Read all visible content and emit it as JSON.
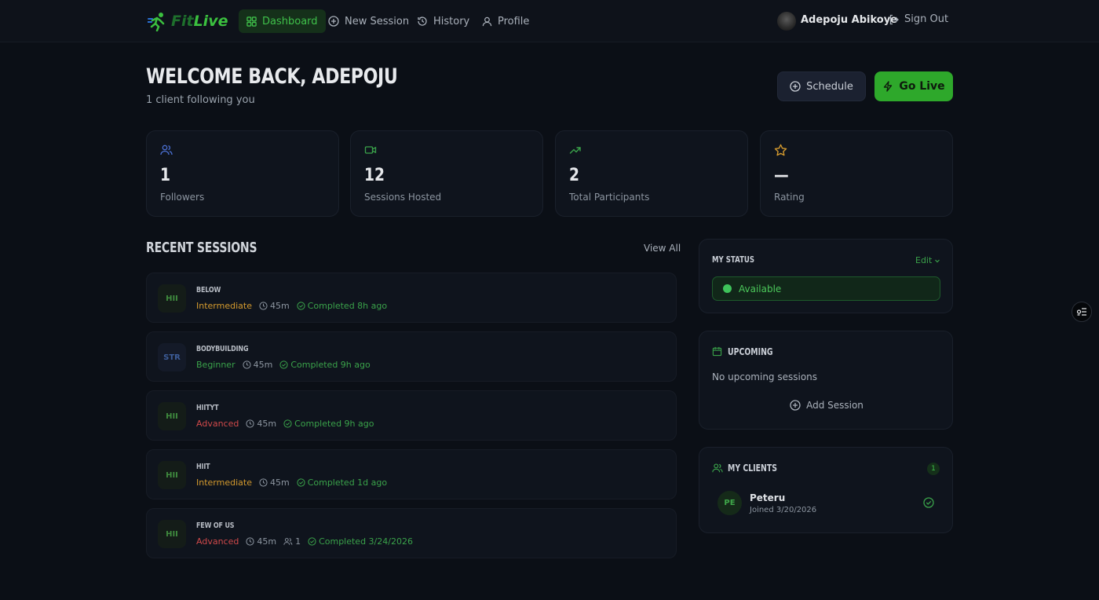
{
  "nav": {
    "logo_fit": "Fit",
    "logo_live": "Live",
    "items": [
      {
        "label": "Dashboard",
        "icon": "grid-icon",
        "active": true
      },
      {
        "label": "New Session",
        "icon": "plus-circle-icon"
      },
      {
        "label": "History",
        "icon": "history-icon"
      },
      {
        "label": "Profile",
        "icon": "user-icon"
      }
    ],
    "user_name": "Adepoju Abikoye",
    "sign_out": "Sign Out"
  },
  "header": {
    "welcome": "WELCOME BACK, ADEPOJU",
    "subtitle": "1 client following you",
    "schedule_label": "Schedule",
    "golive_label": "Go Live"
  },
  "stats": [
    {
      "value": "1",
      "label": "Followers",
      "icon": "users-icon",
      "color": "#4a6fd1"
    },
    {
      "value": "12",
      "label": "Sessions Hosted",
      "icon": "video-icon",
      "color": "#3aa24a"
    },
    {
      "value": "2",
      "label": "Total Participants",
      "icon": "trending-up-icon",
      "color": "#3aa24a"
    },
    {
      "value": "—",
      "label": "Rating",
      "icon": "star-icon",
      "color": "#d49a2e"
    }
  ],
  "recent": {
    "title": "RECENT SESSIONS",
    "view_all": "View All",
    "sessions": [
      {
        "badge": "HII",
        "title": "BELOW",
        "level": "Intermediate",
        "duration": "45m",
        "participants": "",
        "status": "Completed 8h ago"
      },
      {
        "badge": "STR",
        "title": "BODYBUILDING",
        "level": "Beginner",
        "duration": "45m",
        "participants": "",
        "status": "Completed 9h ago"
      },
      {
        "badge": "HII",
        "title": "HIITYT",
        "level": "Advanced",
        "duration": "45m",
        "participants": "",
        "status": "Completed 9h ago"
      },
      {
        "badge": "HII",
        "title": "HIIT",
        "level": "Intermediate",
        "duration": "45m",
        "participants": "",
        "status": "Completed 1d ago"
      },
      {
        "badge": "HII",
        "title": "FEW OF US",
        "level": "Advanced",
        "duration": "45m",
        "participants": "1",
        "status": "Completed 3/24/2026"
      }
    ]
  },
  "status_panel": {
    "title": "MY STATUS",
    "edit": "Edit",
    "value": "Available"
  },
  "upcoming_panel": {
    "title": "UPCOMING",
    "empty": "No upcoming sessions",
    "add": "Add Session"
  },
  "clients_panel": {
    "title": "MY CLIENTS",
    "count": "1",
    "clients": [
      {
        "initials": "PE",
        "name": "Peteru",
        "joined": "Joined 3/20/2026"
      }
    ]
  }
}
